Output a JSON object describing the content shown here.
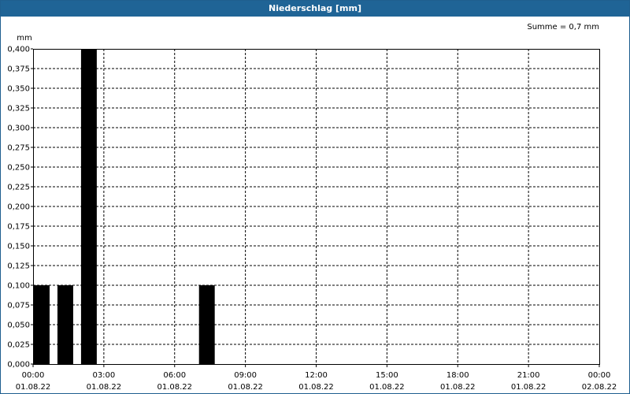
{
  "window": {
    "title": "Niederschlag [mm]"
  },
  "chart_data": {
    "type": "bar",
    "ylabel": "mm",
    "annotation": "Summe = 0,7 mm",
    "ylim": [
      0,
      0.4
    ],
    "y_ticks": [
      "0,000",
      "0,025",
      "0,050",
      "0,075",
      "0,100",
      "0,125",
      "0,150",
      "0,175",
      "0,200",
      "0,225",
      "0,250",
      "0,275",
      "0,300",
      "0,325",
      "0,350",
      "0,375",
      "0,400"
    ],
    "x_ticks": [
      {
        "time": "00:00",
        "date": "01.08.22"
      },
      {
        "time": "03:00",
        "date": "01.08.22"
      },
      {
        "time": "06:00",
        "date": "01.08.22"
      },
      {
        "time": "09:00",
        "date": "01.08.22"
      },
      {
        "time": "12:00",
        "date": "01.08.22"
      },
      {
        "time": "15:00",
        "date": "01.08.22"
      },
      {
        "time": "18:00",
        "date": "01.08.22"
      },
      {
        "time": "21:00",
        "date": "01.08.22"
      },
      {
        "time": "00:00",
        "date": "02.08.22"
      }
    ],
    "grid": true,
    "bar_color": "#000000",
    "bars": [
      {
        "start": "01.08.22 00:00",
        "end": "01.08.22 00:40",
        "value": 0.1
      },
      {
        "start": "01.08.22 01:00",
        "end": "01.08.22 01:40",
        "value": 0.1
      },
      {
        "start": "01.08.22 02:00",
        "end": "01.08.22 02:40",
        "value": 0.4
      },
      {
        "start": "01.08.22 07:00",
        "end": "01.08.22 07:40",
        "value": 0.1
      }
    ]
  }
}
